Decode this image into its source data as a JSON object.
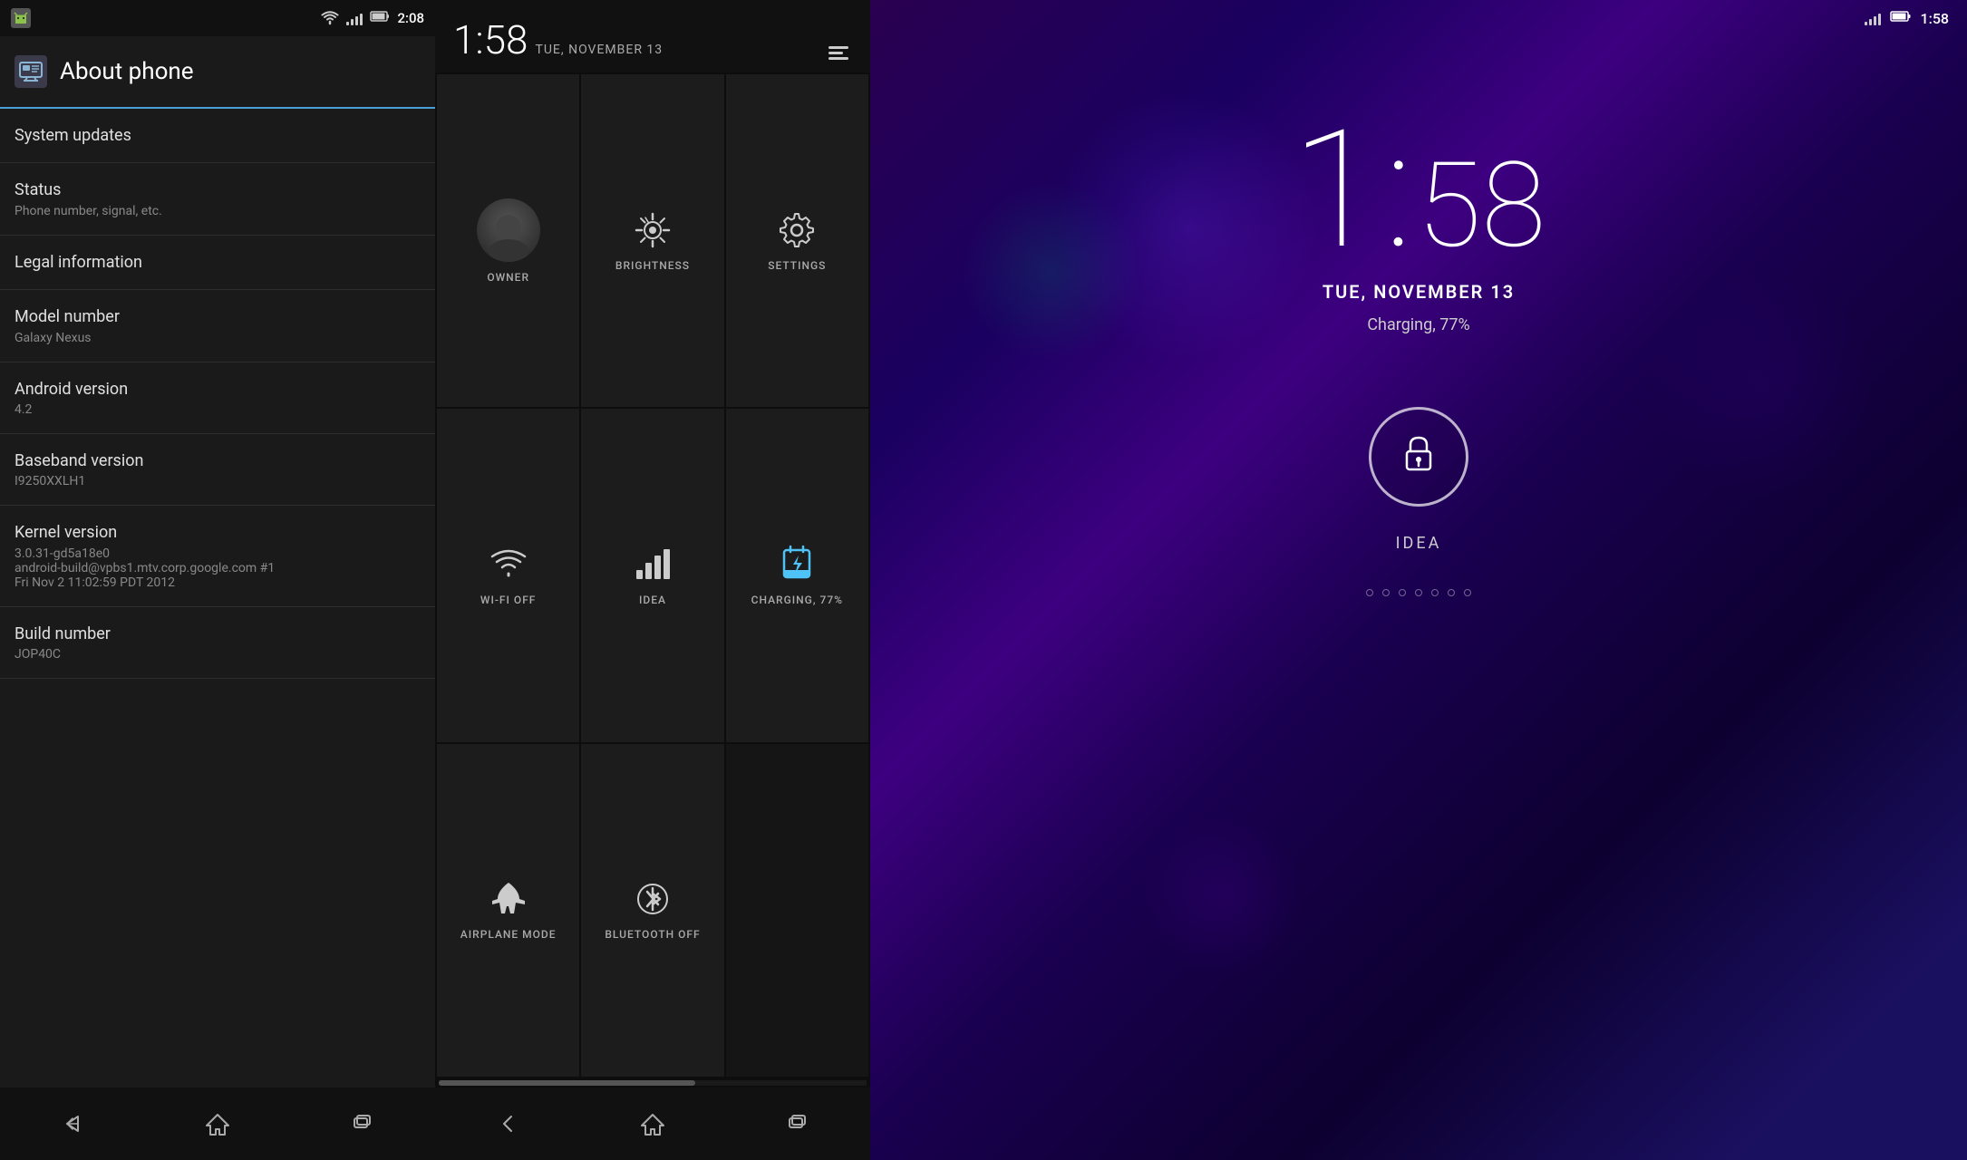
{
  "panel1": {
    "title": "About phone",
    "status_bar": {
      "time": "2:08",
      "icons": [
        "android-icon",
        "wifi-icon",
        "signal-icon",
        "battery-icon"
      ]
    },
    "menu_items": [
      {
        "id": "system-updates",
        "title": "System updates",
        "subtitle": ""
      },
      {
        "id": "status",
        "title": "Status",
        "subtitle": "Phone number, signal, etc."
      },
      {
        "id": "legal-information",
        "title": "Legal information",
        "subtitle": ""
      },
      {
        "id": "model-number",
        "title": "Model number",
        "subtitle": "Galaxy Nexus"
      },
      {
        "id": "android-version",
        "title": "Android version",
        "subtitle": "4.2"
      },
      {
        "id": "baseband-version",
        "title": "Baseband version",
        "subtitle": "I9250XXLH1"
      },
      {
        "id": "kernel-version",
        "title": "Kernel version",
        "subtitle": "3.0.31-gd5a18e0\nandroid-build@vpbs1.mtv.corp.google.com #1\nFri Nov 2 11:02:59 PDT 2012"
      },
      {
        "id": "build-number",
        "title": "Build number",
        "subtitle": "JOP40C"
      }
    ],
    "nav": {
      "back_label": "←",
      "home_label": "⌂",
      "recent_label": "▭"
    }
  },
  "panel2": {
    "time": "1:58",
    "date": "TUE, NOVEMBER 13",
    "tiles": [
      {
        "id": "owner",
        "icon": "person-icon",
        "label": "OWNER"
      },
      {
        "id": "brightness",
        "icon": "brightness-icon",
        "label": "BRIGHTNESS"
      },
      {
        "id": "settings",
        "icon": "settings-icon",
        "label": "SETTINGS"
      },
      {
        "id": "wifi-off",
        "icon": "wifi-off-icon",
        "label": "WI-FI OFF"
      },
      {
        "id": "idea",
        "icon": "signal-icon",
        "label": "IDEA"
      },
      {
        "id": "charging",
        "icon": "charging-icon",
        "label": "CHARGING, 77%"
      },
      {
        "id": "airplane",
        "icon": "airplane-icon",
        "label": "AIRPLANE MODE"
      },
      {
        "id": "bluetooth",
        "icon": "bluetooth-icon",
        "label": "BLUETOOTH OFF"
      }
    ],
    "nav": {
      "back_label": "←",
      "home_label": "⌂",
      "recent_label": "▭"
    }
  },
  "panel3": {
    "time_hour": "1",
    "time_sep": ":",
    "time_min": "58",
    "date": "TUE, NOVEMBER 13",
    "charging_text": "Charging, 77%",
    "carrier": "IDEA",
    "status_bar": {
      "time": "1:58"
    }
  }
}
